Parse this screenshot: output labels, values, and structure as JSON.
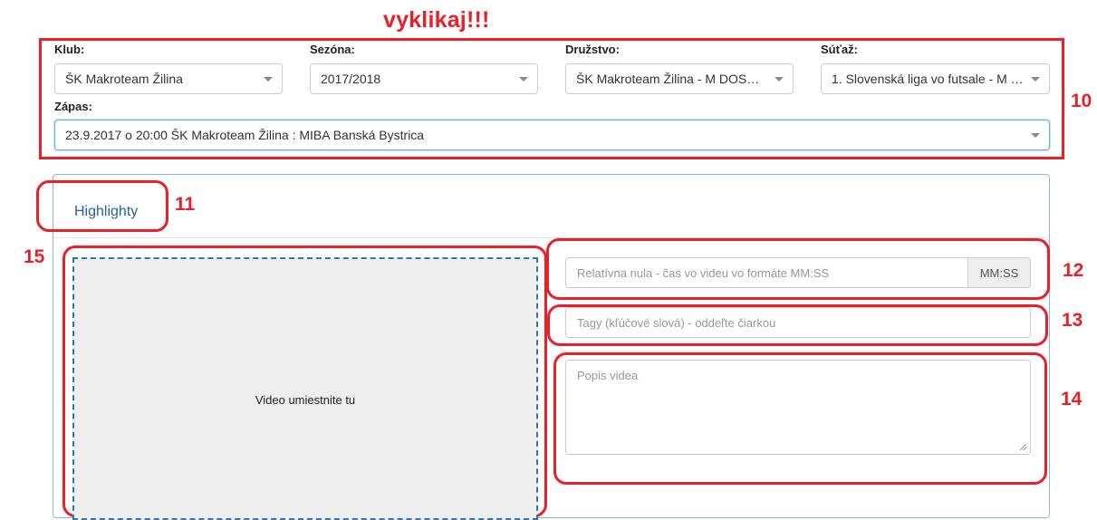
{
  "annotations": {
    "title": "vyklikaj!!!",
    "numbers": {
      "n10": "10",
      "n11": "11",
      "n12": "12",
      "n13": "13",
      "n14": "14",
      "n15": "15"
    },
    "color": "#e8202a"
  },
  "filters": {
    "club": {
      "label": "Klub:",
      "value": "ŠK Makroteam Žilina"
    },
    "season": {
      "label": "Sezóna:",
      "value": "2017/2018"
    },
    "team": {
      "label": "Družstvo:",
      "value": "ŠK Makroteam Žilina - M DOSPEL..."
    },
    "competition": {
      "label": "Súťaž:",
      "value": "1. Slovenská liga vo futsale - M (2..."
    },
    "match": {
      "label": "Zápas:",
      "value": "23.9.2017 o 20:00 ŠK Makroteam Žilina : MIBA Banská Bystrica"
    }
  },
  "panel": {
    "tab_label": "Highlighty",
    "dropzone_text": "Video umiestnite tu",
    "relative_zero": {
      "placeholder": "Relatívna nula - čas vo videu vo formáte MM:SS",
      "addon": "MM:SS"
    },
    "tags": {
      "placeholder": "Tagy (kľúčové slová) - oddeľte čiarkou"
    },
    "description": {
      "placeholder": "Popis videa"
    }
  },
  "colors": {
    "link_blue": "#23629b",
    "focus_border": "#66afe9",
    "dropzone_border": "#2f74b5"
  }
}
